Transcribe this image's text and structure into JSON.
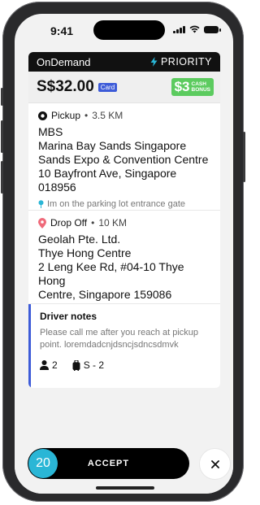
{
  "status_bar": {
    "time": "9:41",
    "icons": [
      "signal-icon",
      "wifi-icon",
      "battery-icon"
    ]
  },
  "header": {
    "title": "OnDemand",
    "priority_label": "PRIORITY",
    "priority_icon": "lightning-icon"
  },
  "price_row": {
    "price": "S$32.00",
    "payment_badge": "Card",
    "cash_bonus_amount": "$3",
    "cash_bonus_label_line1": "CASH",
    "cash_bonus_label_line2": "BONUS"
  },
  "pickup": {
    "label": "Pickup",
    "distance": "3.5 KM",
    "address_lines": [
      "MBS",
      "Marina Bay Sands Singapore",
      "Sands Expo & Convention Centre",
      "10 Bayfront Ave, Singapore 018956"
    ],
    "note": "Im on the parking lot entrance gate"
  },
  "dropoff": {
    "label": "Drop Off",
    "distance": "10 KM",
    "address_lines": [
      "Geolah Pte. Ltd.",
      "Thye Hong Centre",
      "2 Leng Kee Rd, #04-10 Thye Hong",
      "Centre, Singapore 159086"
    ]
  },
  "driver_notes": {
    "title": "Driver notes",
    "text": "Please call me after you reach at pickup point. loremdadcnjdsncjsdncsdmvk",
    "passengers": "2",
    "luggage": "S - 2"
  },
  "actions": {
    "countdown": "20",
    "accept_label": "ACCEPT",
    "close_symbol": "×"
  },
  "colors": {
    "accent_blue": "#3d5bd8",
    "cash_green": "#5ccb5f",
    "timer_cyan": "#2ab6d6",
    "dropoff_pin": "#ef6a7a",
    "note_pin": "#2ab6d6"
  }
}
